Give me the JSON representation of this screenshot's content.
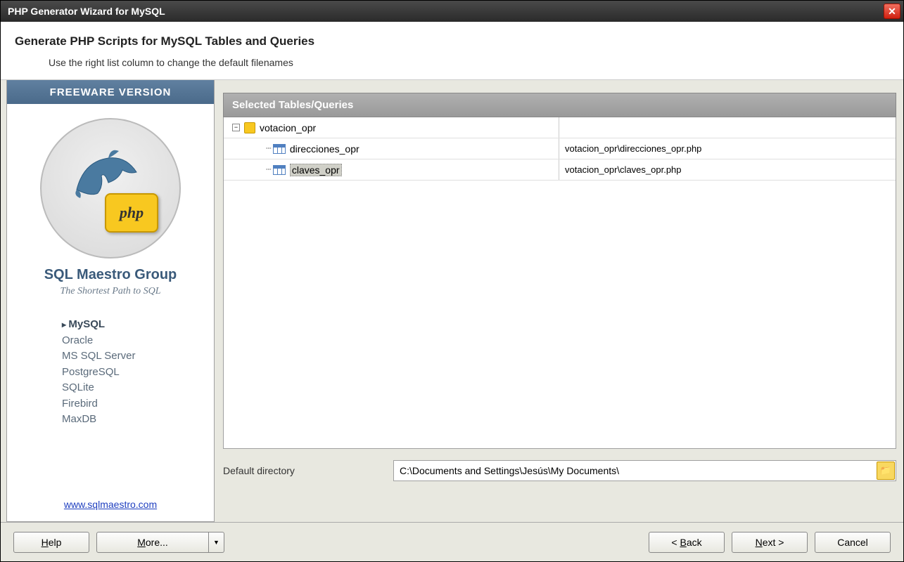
{
  "titlebar": {
    "title": "PHP Generator Wizard for MySQL"
  },
  "header": {
    "title": "Generate PHP Scripts for MySQL Tables and Queries",
    "subtitle": "Use the right list column to change the default filenames"
  },
  "sidebar": {
    "banner": "FREEWARE VERSION",
    "php_label": "php",
    "group": "SQL Maestro Group",
    "tagline": "The Shortest Path to SQL",
    "db_list": [
      "MySQL",
      "Oracle",
      "MS SQL Server",
      "PostgreSQL",
      "SQLite",
      "Firebird",
      "MaxDB"
    ],
    "active_db_index": 0,
    "link": "www.sqlmaestro.com"
  },
  "main": {
    "panel_title": "Selected Tables/Queries",
    "tree": {
      "database": "votacion_opr",
      "tables": [
        {
          "name": "direcciones_opr",
          "file": "votacion_opr\\direcciones_opr.php",
          "selected": false
        },
        {
          "name": "claves_opr",
          "file": "votacion_opr\\claves_opr.php",
          "selected": true
        }
      ]
    },
    "dir_label": "Default directory",
    "dir_value": "C:\\Documents and Settings\\Jesús\\My Documents\\"
  },
  "footer": {
    "help": "Help",
    "more": "More...",
    "back": "< Back",
    "next": "Next >",
    "cancel": "Cancel"
  }
}
